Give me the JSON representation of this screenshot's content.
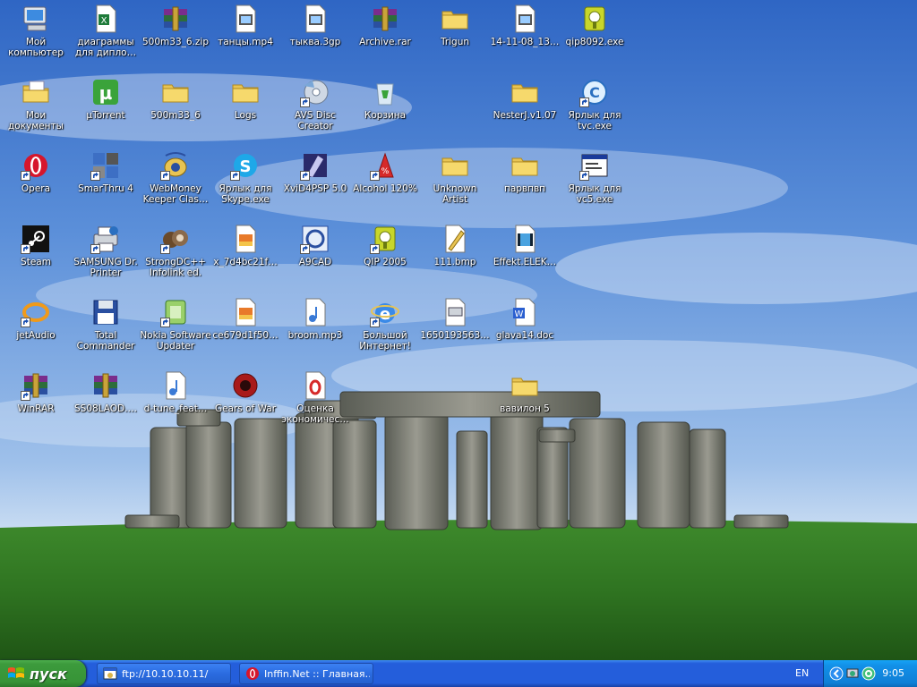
{
  "desktop": {
    "icons": [
      {
        "label": "Мой компьютер",
        "icon": "my-computer-icon",
        "shortcut": false
      },
      {
        "label": "диаграммы для дипло…",
        "icon": "excel-file-icon",
        "shortcut": false
      },
      {
        "label": "500m33_6.zip",
        "icon": "rar-archive-icon",
        "shortcut": false
      },
      {
        "label": "танцы.mp4",
        "icon": "video-file-icon",
        "shortcut": false
      },
      {
        "label": "тыква.3gp",
        "icon": "video-file-icon",
        "shortcut": false
      },
      {
        "label": "Archive.rar",
        "icon": "rar-archive-icon",
        "shortcut": false
      },
      {
        "label": "Trigun",
        "icon": "folder-icon",
        "shortcut": false
      },
      {
        "label": "14-11-08_13…",
        "icon": "video-file-icon",
        "shortcut": false
      },
      {
        "label": "qip8092.exe",
        "icon": "qip-icon",
        "shortcut": false
      },
      {
        "label": "Мои документы",
        "icon": "my-documents-icon",
        "shortcut": false
      },
      {
        "label": "µTorrent",
        "icon": "utorrent-icon",
        "shortcut": false
      },
      {
        "label": "500m33_6",
        "icon": "folder-icon",
        "shortcut": false
      },
      {
        "label": "Logs",
        "icon": "folder-icon",
        "shortcut": false
      },
      {
        "label": "AVS Disc Creator",
        "icon": "disc-creator-icon",
        "shortcut": true
      },
      {
        "label": "Корзина",
        "icon": "recycle-bin-icon",
        "shortcut": false
      },
      {
        "label": "NesterJ.v1.07",
        "icon": "folder-icon",
        "shortcut": false
      },
      {
        "label": "Ярлык для tvc.exe",
        "icon": "tvc-icon",
        "shortcut": true
      },
      {
        "label": "Opera",
        "icon": "opera-icon",
        "shortcut": true
      },
      {
        "label": "SmarThru 4",
        "icon": "smarthru-icon",
        "shortcut": true
      },
      {
        "label": "WebMoney Keeper Clas…",
        "icon": "webmoney-icon",
        "shortcut": true
      },
      {
        "label": "Ярлык для Skype.exe",
        "icon": "skype-icon",
        "shortcut": true
      },
      {
        "label": "XviD4PSP 5.0",
        "icon": "xvid-icon",
        "shortcut": true
      },
      {
        "label": "Alcohol 120%",
        "icon": "alcohol-icon",
        "shortcut": true
      },
      {
        "label": "Unknown Artist",
        "icon": "folder-icon",
        "shortcut": false
      },
      {
        "label": "парвпвп",
        "icon": "folder-icon",
        "shortcut": false
      },
      {
        "label": "Ярлык для vc5.exe",
        "icon": "window-app-icon",
        "shortcut": true
      },
      {
        "label": "Steam",
        "icon": "steam-icon",
        "shortcut": true
      },
      {
        "label": "SAMSUNG Dr. Printer",
        "icon": "printer-icon",
        "shortcut": true
      },
      {
        "label": "StrongDC++ Infolink ed.",
        "icon": "strongdc-icon",
        "shortcut": true
      },
      {
        "label": "x_7d4bc21f…",
        "icon": "image-file-icon",
        "shortcut": false
      },
      {
        "label": "A9CAD",
        "icon": "a9cad-icon",
        "shortcut": true
      },
      {
        "label": "QIP 2005",
        "icon": "qip-icon",
        "shortcut": true
      },
      {
        "label": "111.bmp",
        "icon": "bmp-file-icon",
        "shortcut": false
      },
      {
        "label": "Effekt.ELEK…",
        "icon": "film-file-icon",
        "shortcut": false
      },
      {
        "label": "jetAudio",
        "icon": "jetaudio-icon",
        "shortcut": true
      },
      {
        "label": "Total Commander",
        "icon": "floppy-disk-icon",
        "shortcut": false
      },
      {
        "label": "Nokia Software Updater",
        "icon": "nokia-updater-icon",
        "shortcut": true
      },
      {
        "label": "ce679d1f50…",
        "icon": "image-file-icon",
        "shortcut": false
      },
      {
        "label": "broom.mp3",
        "icon": "audio-file-icon",
        "shortcut": false
      },
      {
        "label": "Большой Интернет!",
        "icon": "internet-explorer-icon",
        "shortcut": true
      },
      {
        "label": "1650193563…",
        "icon": "document-file-icon",
        "shortcut": false
      },
      {
        "label": "glava14.doc",
        "icon": "word-document-icon",
        "shortcut": false
      },
      {
        "label": "WinRAR",
        "icon": "rar-archive-icon",
        "shortcut": true
      },
      {
        "label": "SS08LAOD.…",
        "icon": "rar-archive-icon",
        "shortcut": false
      },
      {
        "label": "d-tune_feat…",
        "icon": "audio-file-icon",
        "shortcut": false
      },
      {
        "label": "Gears of War",
        "icon": "gears-of-war-icon",
        "shortcut": false
      },
      {
        "label": "Оценка экономичес…",
        "icon": "pdf-file-icon",
        "shortcut": false
      },
      {
        "label": "вавилон 5",
        "icon": "folder-icon",
        "shortcut": false
      }
    ]
  },
  "taskbar": {
    "start_label": "пуск",
    "tasks": [
      {
        "label": "ftp://10.10.10.11/",
        "icon": "ftp-window-icon"
      },
      {
        "label": "Inffin.Net :: Главная…",
        "icon": "opera-icon"
      }
    ],
    "language": "EN",
    "clock": "9:05"
  },
  "colors": {
    "taskbar_blue": "#245edb",
    "start_green": "#379437",
    "tray_blue": "#0f7fd6",
    "label_text": "#ffffff"
  }
}
